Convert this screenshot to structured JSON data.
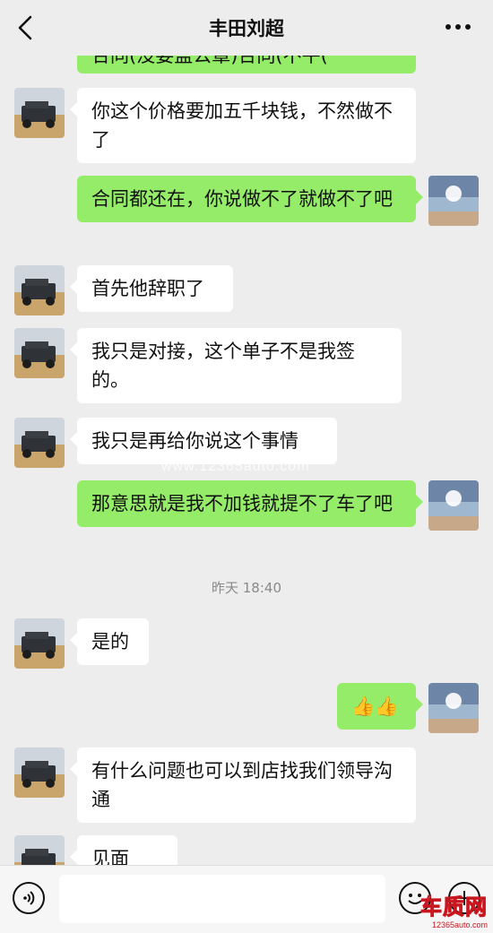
{
  "header": {
    "title": "丰田刘超",
    "back_icon": "chevron-left-icon",
    "more_icon": "ellipsis-icon"
  },
  "messages": [
    {
      "side": "out",
      "text": "合同(没要盖公章)合同(不平("
    },
    {
      "side": "in",
      "text": "你这个价格要加五千块钱，不然做不了"
    },
    {
      "side": "out",
      "text": "合同都还在，你说做不了就做不了吧"
    },
    {
      "side": "in",
      "text": "首先他辞职了"
    },
    {
      "side": "in",
      "text": "我只是对接，这个单子不是我签的。"
    },
    {
      "side": "in",
      "text": "我只是再给你说这个事情"
    },
    {
      "side": "out",
      "text": "那意思就是我不加钱就提不了车了吧"
    },
    {
      "side": "in",
      "text": "是的"
    },
    {
      "side": "out",
      "text": "👍👍"
    },
    {
      "side": "in",
      "text": "有什么问题也可以到店找我们领导沟通"
    },
    {
      "side": "in",
      "text": "见面聊。"
    }
  ],
  "timestamp": "昨天 18:40",
  "watermark": "www.12365auto.com",
  "input_bar": {
    "voice_icon": "voice-icon",
    "placeholder": "",
    "emoji_icon": "emoji-icon",
    "plus_icon": "plus-icon"
  },
  "logo": {
    "main": "车质网",
    "sub": "12365auto.com"
  },
  "colors": {
    "background": "#ededed",
    "out_bubble": "#95ec69",
    "in_bubble": "#ffffff",
    "logo_red": "#c9151e"
  }
}
